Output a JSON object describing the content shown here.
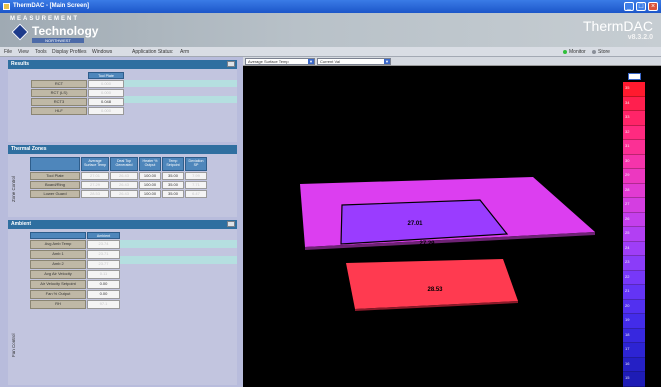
{
  "window": {
    "title": "ThermDAC - [Main Screen]",
    "buttons": [
      "_",
      "□",
      "×"
    ]
  },
  "banner": {
    "logo_top": "MEASUREMENT",
    "logo_name": "Technology",
    "logo_sub": "NORTHWEST",
    "product": "ThermDAC",
    "version": "v8.3.2.0"
  },
  "menu": {
    "items": [
      "File",
      "View",
      "Tools",
      "Display Profiles",
      "Windows"
    ],
    "app_status_label": "Application Status:",
    "app_status_value": "Arm",
    "right_items": [
      "Monitor",
      "Store"
    ]
  },
  "results": {
    "title": "Results",
    "column": "Tool Plate",
    "rows": [
      {
        "label": "RCT",
        "value": "0.000",
        "dim": true
      },
      {
        "label": "RCT (LS)",
        "value": "0.000",
        "dim": true
      },
      {
        "label": "RCT3",
        "value": "0.048",
        "dim": false
      },
      {
        "label": "HLF",
        "value": "0.000",
        "dim": true
      }
    ]
  },
  "thermal": {
    "title": "Thermal Zones",
    "side_label": "Zone Control",
    "columns": [
      "Average Surface Temp",
      "Deal Top Generated",
      "Heater % Output",
      "Temp Setpoint",
      "Deviation SP"
    ],
    "rows": [
      {
        "label": "Tool Plate",
        "values": [
          "27.01",
          "26.43",
          "100.00",
          "35.00",
          "7.99"
        ]
      },
      {
        "label": "Board/Ring",
        "values": [
          "27.29",
          "26.43",
          "100.00",
          "35.00",
          "7.71"
        ]
      },
      {
        "label": "Lower Guard",
        "values": [
          "28.53",
          "26.43",
          "100.00",
          "35.00",
          "6.47"
        ]
      }
    ],
    "dim_cols": [
      0,
      1,
      4
    ]
  },
  "ambient": {
    "title": "Ambient",
    "side_label": "Fan Control",
    "column": "Ambient",
    "rows": [
      {
        "label": "Avg Amb Temp",
        "value": "23.74",
        "dim": true
      },
      {
        "label": "Amb 1",
        "value": "23.71",
        "dim": true
      },
      {
        "label": "Amb 2",
        "value": "23.77",
        "dim": true
      },
      {
        "label": "Avg Air Velocity",
        "value": "0.11",
        "dim": true
      },
      {
        "label": "Air Velocity Setpoint",
        "value": "0.00",
        "dim": false
      },
      {
        "label": "Fan % Output",
        "value": "0.00",
        "dim": false
      },
      {
        "label": "RH",
        "value": "97.1",
        "dim": true
      }
    ]
  },
  "viewer": {
    "display_select": "Average Surface Temp",
    "mode_select": "Current Val",
    "top_label": "27.01",
    "middle_label": "27.29",
    "bottom_label": "28.53",
    "colors": {
      "top_plate": "#9a3cff",
      "middle_plate": "#dc3ef0",
      "bottom_plate": "#ff3a50"
    }
  },
  "legend": {
    "labels": [
      "35",
      "34",
      "33",
      "32",
      "31",
      "30",
      "29",
      "28",
      "27",
      "26",
      "25",
      "24",
      "23",
      "22",
      "21",
      "20",
      "19",
      "18",
      "17",
      "16",
      "15"
    ],
    "colors": [
      "#ff1a2e",
      "#ff1f4e",
      "#ff2468",
      "#ff2a80",
      "#fb3095",
      "#f534ab",
      "#ec38c0",
      "#e13bd2",
      "#d43ee1",
      "#c43fec",
      "#b23ff3",
      "#9f3ef7",
      "#8b3cf9",
      "#7738f8",
      "#6434f5",
      "#5230f0",
      "#432ce9",
      "#3728df",
      "#2d24d3",
      "#2520c5",
      "#1e1cb5"
    ]
  }
}
